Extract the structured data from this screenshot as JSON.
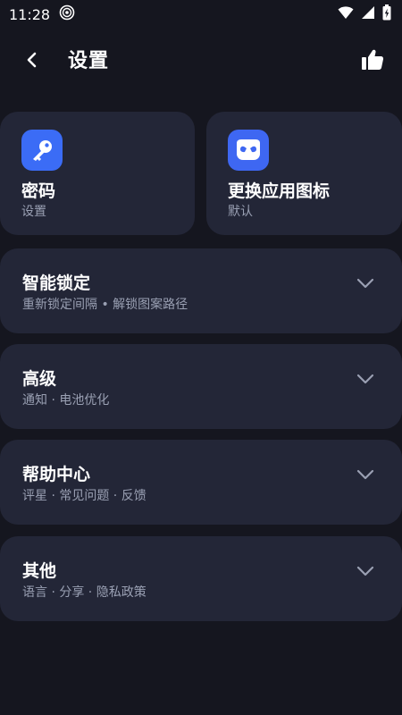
{
  "status_bar": {
    "time": "11:28",
    "icons": [
      "focus-mode-icon",
      "wifi-icon",
      "signal-icon",
      "battery-charging-icon"
    ]
  },
  "app_bar": {
    "title": "设置",
    "back_icon": "chevron-left-icon",
    "action_icon": "thumbs-up-icon"
  },
  "top_cards": [
    {
      "title": "密码",
      "subtitle": "设置",
      "icon": "key-icon",
      "color": "#3b6cf6"
    },
    {
      "title": "更换应用图标",
      "subtitle": "默认",
      "icon": "mask-icon",
      "color": "#3e67f2"
    }
  ],
  "sections": [
    {
      "title": "智能锁定",
      "subtitle": "重新锁定间隔 • 解锁图案路径"
    },
    {
      "title": "高级",
      "subtitle": "通知 · 电池优化"
    },
    {
      "title": "帮助中心",
      "subtitle": "评星 · 常见问题 · 反馈"
    },
    {
      "title": "其他",
      "subtitle": "语言 · 分享 · 隐私政策"
    }
  ],
  "colors": {
    "background": "#15161f",
    "card": "#232637",
    "accent": "#3b6cf6",
    "subtext": "#9aa0b3"
  }
}
